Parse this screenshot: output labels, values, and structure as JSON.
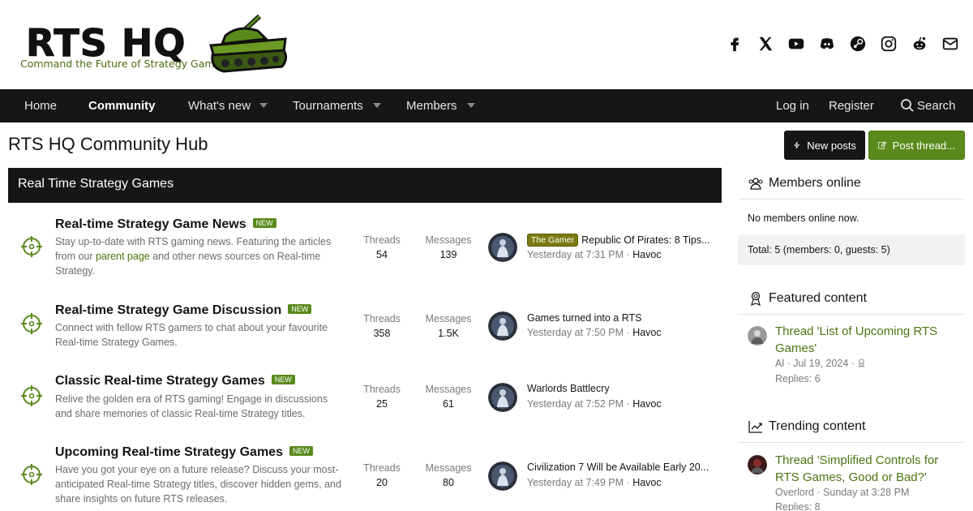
{
  "brand": {
    "name": "RTS HQ",
    "tagline": "Command the Future of Strategy Gaming"
  },
  "socials": [
    "facebook-icon",
    "x-icon",
    "youtube-icon",
    "discord-icon",
    "steam-icon",
    "instagram-icon",
    "reddit-icon",
    "mail-icon"
  ],
  "nav": {
    "home": "Home",
    "community": "Community",
    "whats_new": "What's new",
    "tournaments": "Tournaments",
    "members": "Members",
    "login": "Log in",
    "register": "Register",
    "search": "Search"
  },
  "page": {
    "title": "RTS HQ Community Hub",
    "new_posts": "New posts",
    "post_thread": "Post thread..."
  },
  "category": {
    "title": "Real Time Strategy Games",
    "forums": [
      {
        "title": "Real-time Strategy Game News",
        "badge": "NEW",
        "desc_a": "Stay up-to-date with RTS gaming news. Featuring the articles from our ",
        "desc_link": "parent page",
        "desc_b": " and other news sources on Real-time Strategy.",
        "threads_label": "Threads",
        "threads": "54",
        "messages_label": "Messages",
        "messages": "139",
        "last_prefix": "The Gamer",
        "last_title": "Republic Of Pirates: 8 Tips...",
        "last_time": "Yesterday at 7:31 PM",
        "last_sep": "·",
        "last_user": "Havoc"
      },
      {
        "title": "Real-time Strategy Game Discussion",
        "badge": "NEW",
        "desc": "Connect with fellow RTS gamers to chat about your favourite Real-time Strategy Games.",
        "threads_label": "Threads",
        "threads": "358",
        "messages_label": "Messages",
        "messages": "1.5K",
        "last_title": "Games turned into a RTS",
        "last_time": "Yesterday at 7:50 PM",
        "last_sep": "·",
        "last_user": "Havoc"
      },
      {
        "title": "Classic Real-time Strategy Games",
        "badge": "NEW",
        "desc": "Relive the golden era of RTS gaming! Engage in discussions and share memories of classic Real-time Strategy titles.",
        "threads_label": "Threads",
        "threads": "25",
        "messages_label": "Messages",
        "messages": "61",
        "last_title": "Warlords Battlecry",
        "last_time": "Yesterday at 7:52 PM",
        "last_sep": "·",
        "last_user": "Havoc"
      },
      {
        "title": "Upcoming Real-time Strategy Games",
        "badge": "NEW",
        "desc": "Have you got your eye on a future release? Discuss your most-anticipated Real-time Strategy titles, discover hidden gems, and share insights on future RTS releases.",
        "threads_label": "Threads",
        "threads": "20",
        "messages_label": "Messages",
        "messages": "80",
        "last_title": "Civilization 7 Will be Available Early 20...",
        "last_time": "Yesterday at 7:49 PM",
        "last_sep": "·",
        "last_user": "Havoc"
      }
    ]
  },
  "sidebar": {
    "members_online": {
      "title": "Members online",
      "none": "No members online now.",
      "total": "Total: 5 (members: 0, guests: 5)"
    },
    "featured": {
      "title": "Featured content",
      "item_title": "Thread 'List of Upcoming RTS Games'",
      "item_meta": "Al · Jul 19, 2024 ·",
      "item_replies": "Replies: 6"
    },
    "trending": {
      "title": "Trending content",
      "item_title": "Thread 'Simplified Controls for RTS Games, Good or Bad?'",
      "item_meta": "Overlord · Sunday at 3:28 PM",
      "item_replies": "Replies: 8"
    }
  },
  "colors": {
    "accent": "#5a8a1c",
    "dark": "#161616",
    "link": "#4a7510"
  }
}
